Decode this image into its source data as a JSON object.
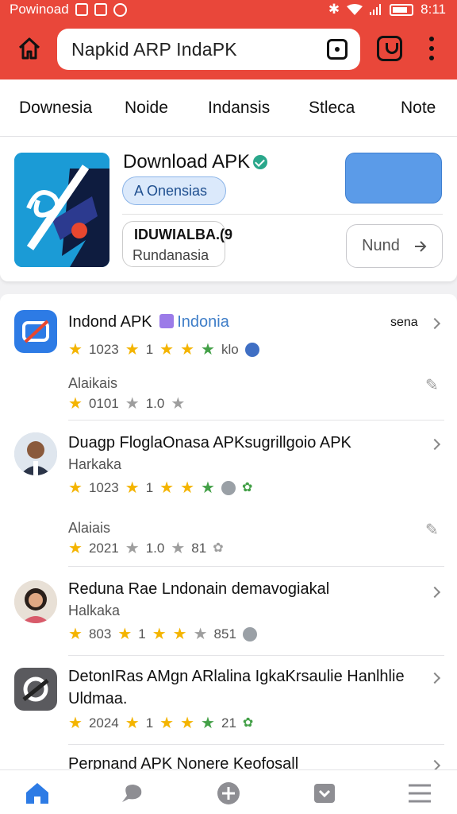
{
  "status_bar": {
    "app_name": "Powinoad",
    "time": "8:11"
  },
  "url_bar": {
    "text": "Napkid ARP IndaPK"
  },
  "tabs": [
    "Downesia",
    "Noide",
    "Indansis",
    "Stleca",
    "Note"
  ],
  "hero": {
    "title": "Download APK",
    "chip": "A Onensias",
    "sub_title": "IDUWIALBA.(9",
    "sub_text": "Rundanasia",
    "button": "Nund"
  },
  "items": [
    {
      "title": "Indond APK",
      "tag": "Indonia",
      "extra": "sena",
      "rating": {
        "value": "1023",
        "mid": "1",
        "end": "klo"
      },
      "sub_label": "Alaikais",
      "sub_rating": {
        "value": "0101",
        "mid": "1.0"
      }
    },
    {
      "title": "Duagp FloglaOnasa APKsugrillgoio APK",
      "subtitle": "Harkaka",
      "rating": {
        "value": "1023",
        "mid": "1"
      },
      "sub_label": "Alaiais",
      "sub_rating": {
        "value": "2021",
        "mid": "1.0",
        "end": "81"
      }
    },
    {
      "title": "Reduna Rae Lndonain demavogiakal",
      "subtitle": "Halkaka",
      "rating": {
        "value": "803",
        "mid": "1",
        "end": "851"
      }
    },
    {
      "title": "DetonIRas AMgn ARlalina IgkaKrsaulie Hanlhlie",
      "subtitle": "Uldmaa.",
      "rating": {
        "value": "2024",
        "mid": "1",
        "end": "21"
      }
    },
    {
      "title": "Perpnand APK Nonere Keofosall"
    }
  ],
  "colors": {
    "brand": "#e9473a",
    "accent": "#2d7be5",
    "star": "#f4b400",
    "star_green": "#43a047"
  }
}
